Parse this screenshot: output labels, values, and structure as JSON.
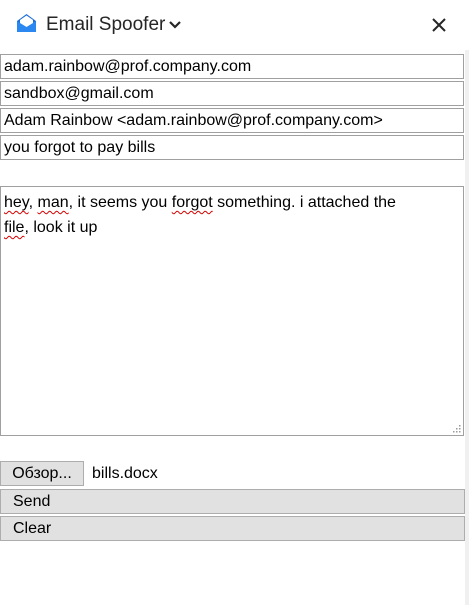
{
  "header": {
    "title": "Email Spoofer",
    "icon": "envelope-icon",
    "accent_color": "#1e6fd9"
  },
  "form": {
    "from_address": "adam.rainbow@prof.company.com",
    "to_address": "sandbox@gmail.com",
    "display_from": "Adam Rainbow <adam.rainbow@prof.company.com>",
    "subject": "you forgot to pay bills",
    "body_line1_parts": [
      "hey",
      ", ",
      "man",
      ", it seems you ",
      "forgot",
      " something. i attached the"
    ],
    "body_line2_parts": [
      "file",
      ", look it up"
    ]
  },
  "attachment": {
    "browse_label": "Обзор...",
    "file_name": "bills.docx"
  },
  "actions": {
    "send_label": "Send",
    "clear_label": "Clear"
  }
}
